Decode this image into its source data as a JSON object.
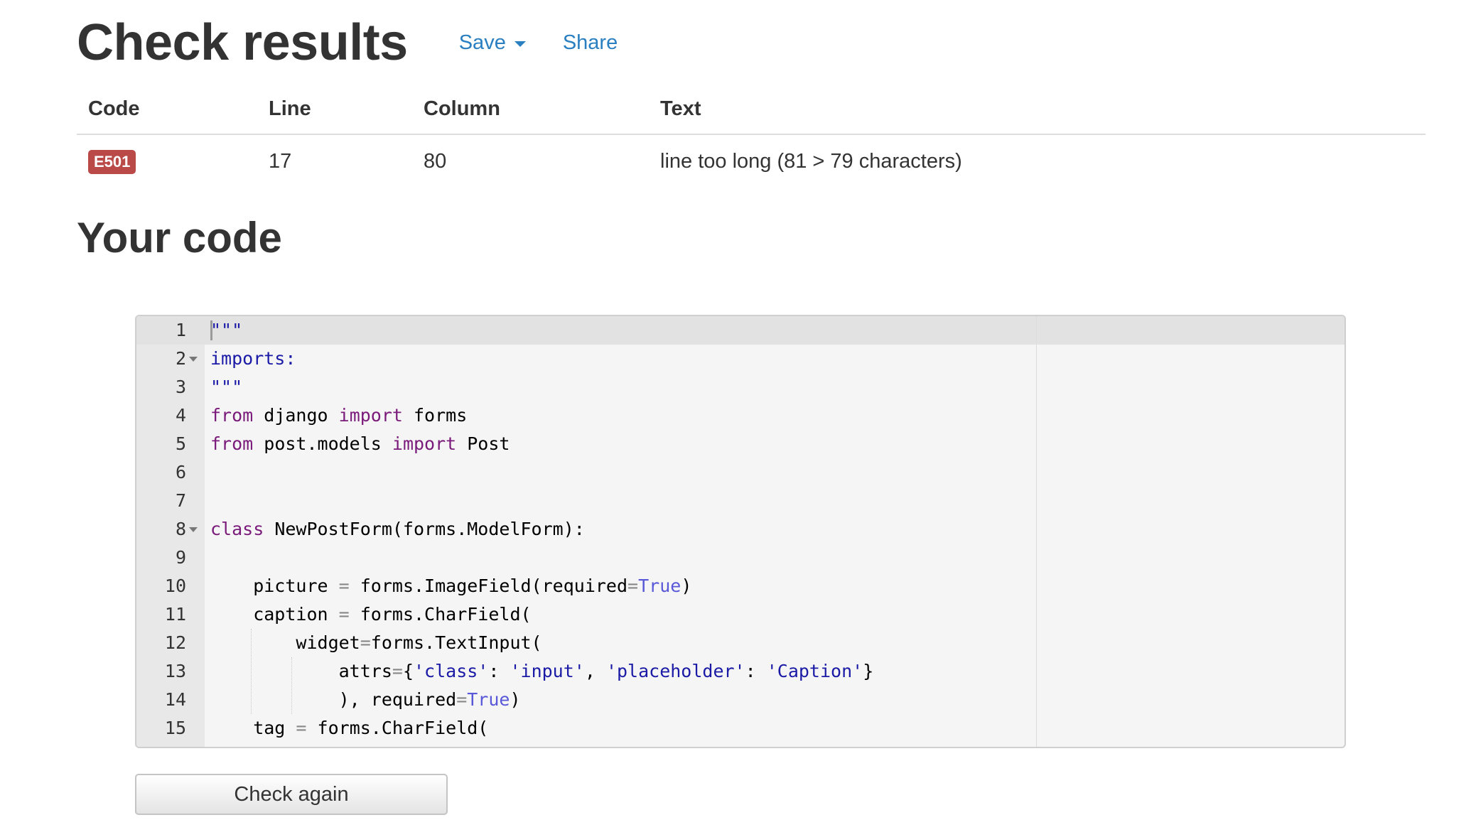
{
  "header": {
    "title": "Check results",
    "save_label": "Save",
    "share_label": "Share"
  },
  "results": {
    "columns": [
      "Code",
      "Line",
      "Column",
      "Text"
    ],
    "rows": [
      {
        "code": "E501",
        "line": "17",
        "column": "80",
        "text": "line too long (81 > 79 characters)"
      }
    ],
    "badge_color": "#b94a48"
  },
  "code_section": {
    "title": "Your code",
    "line_numbers": [
      "1",
      "2",
      "3",
      "4",
      "5",
      "6",
      "7",
      "8",
      "9",
      "10",
      "11",
      "12",
      "13",
      "14",
      "15"
    ],
    "foldable_lines": [
      2,
      8
    ],
    "icons": {
      "fold": "fold-arrow-icon"
    }
  },
  "actions": {
    "check_again_label": "Check again"
  },
  "colors": {
    "link": "#2a7fc1",
    "keyword": "#7a1a7a",
    "string": "#1a1aa6",
    "boolean": "#5858d8"
  }
}
